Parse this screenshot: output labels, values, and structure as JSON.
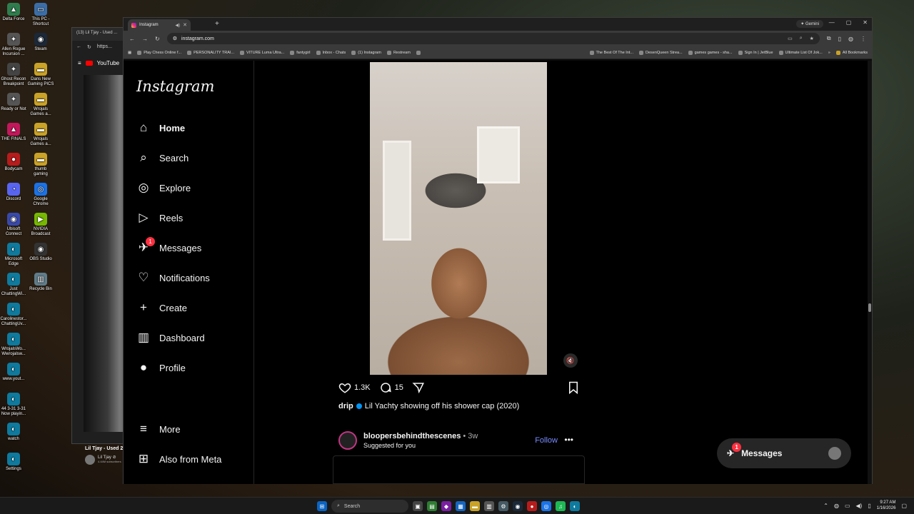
{
  "desktop": {
    "icons": [
      {
        "label": "Delta Force",
        "glyph": "▲",
        "color": "#2f7d4e"
      },
      {
        "label": "This PC - Shortcut",
        "glyph": "▭",
        "color": "#3b6ea8"
      },
      {
        "label": "Allen Rogue Incursion ...",
        "glyph": "✦",
        "color": "#555"
      },
      {
        "label": "Steam",
        "glyph": "◉",
        "color": "#1b2838"
      },
      {
        "label": "Ghost Recon Breakpoint",
        "glyph": "✦",
        "color": "#444"
      },
      {
        "label": "Dans New Gaming PICS",
        "glyph": "▬",
        "color": "#c9a227"
      },
      {
        "label": "Ready or Not",
        "glyph": "✦",
        "color": "#555"
      },
      {
        "label": "Wrojals Games a...",
        "glyph": "▬",
        "color": "#c9a227"
      },
      {
        "label": "THE FINALS",
        "glyph": "▲",
        "color": "#c2185b"
      },
      {
        "label": "Wrojals Games a...",
        "glyph": "▬",
        "color": "#c9a227"
      },
      {
        "label": "Bodycam",
        "glyph": "●",
        "color": "#b71c1c"
      },
      {
        "label": "thumb gaming",
        "glyph": "▬",
        "color": "#c9a227"
      },
      {
        "label": "Discord",
        "glyph": "◔",
        "color": "#5865f2"
      },
      {
        "label": "Google Chrome",
        "glyph": "◎",
        "color": "#1a73e8"
      },
      {
        "label": "Ubisoft Connect",
        "glyph": "◉",
        "color": "#3949ab"
      },
      {
        "label": "NVIDIA Broadcast",
        "glyph": "▶",
        "color": "#76b900"
      },
      {
        "label": "Microsoft Edge",
        "glyph": "◐",
        "color": "#0e7a9e"
      },
      {
        "label": "OBS Studio",
        "glyph": "◉",
        "color": "#333"
      },
      {
        "label": "Just ChattingWi...",
        "glyph": "◐",
        "color": "#0e7a9e"
      },
      {
        "label": "Recycle Bin",
        "glyph": "▥",
        "color": "#607d8b"
      },
      {
        "label": "Carolinestor... ChattingUv...",
        "glyph": "◐",
        "color": "#0e7a9e"
      },
      {
        "label": "WrojalsWo... Wwrojalsw...",
        "glyph": "◐",
        "color": "#0e7a9e"
      },
      {
        "label": "www.yout...",
        "glyph": "◐",
        "color": "#0e7a9e"
      },
      {
        "label": "44 3-31 3-31 Now playin...",
        "glyph": "◐",
        "color": "#0e7a9e"
      },
      {
        "label": "watch",
        "glyph": "◐",
        "color": "#0e7a9e"
      },
      {
        "label": "Settings",
        "glyph": "◐",
        "color": "#0e7a9e"
      }
    ]
  },
  "youtube_window": {
    "tab_title": "(13) Lil Tjay - Used ...",
    "address": "https...",
    "brand": "YouTube",
    "video_title": "Lil Tjay - Used 2...",
    "channel": "Lil Tjay ⊘",
    "subscribers": "4.44M subscribers"
  },
  "browser": {
    "tab_title": "Instagram",
    "gemini_label": "Gemini",
    "url": "instagram.com",
    "bookmarks_left": [
      "Play Chess Online f...",
      "PERSONALITY TRAI...",
      "VITURE Luma Ultra...",
      "fantygirl",
      "Inbox - Chats",
      "(1) Instagram",
      "Restream",
      ""
    ],
    "bookmarks_right": [
      "The Best Of The Int...",
      "DesenQueen Strea...",
      "games games - sha...",
      "Sign In | JetBlue",
      "Ultimate List Of Jok..."
    ],
    "all_bookmarks": "All Bookmarks"
  },
  "instagram": {
    "logo": "Instagram",
    "nav": [
      {
        "label": "Home",
        "icon": "home-icon",
        "glyph": "⌂"
      },
      {
        "label": "Search",
        "icon": "search-icon",
        "glyph": "⌕"
      },
      {
        "label": "Explore",
        "icon": "compass-icon",
        "glyph": "◎"
      },
      {
        "label": "Reels",
        "icon": "reels-icon",
        "glyph": "▷"
      },
      {
        "label": "Messages",
        "icon": "messenger-icon",
        "glyph": "✈",
        "badge": "1"
      },
      {
        "label": "Notifications",
        "icon": "heart-icon",
        "glyph": "♡"
      },
      {
        "label": "Create",
        "icon": "plus-icon",
        "glyph": "+"
      },
      {
        "label": "Dashboard",
        "icon": "chart-icon",
        "glyph": "▥"
      },
      {
        "label": "Profile",
        "icon": "avatar-icon",
        "glyph": "●"
      }
    ],
    "bottom_nav": [
      {
        "label": "More",
        "icon": "menu-icon",
        "glyph": "≡"
      },
      {
        "label": "Also from Meta",
        "icon": "meta-icon",
        "glyph": "⊞"
      }
    ],
    "post": {
      "likes": "1.3K",
      "comments": "15",
      "author": "drip",
      "caption": "Lil Yachty showing off his shower cap (2020)"
    },
    "suggested": {
      "username": "bloopersbehindthescenes",
      "age": "• 3w",
      "subtitle": "Suggested for you",
      "follow": "Follow"
    },
    "messages_pill": {
      "label": "Messages",
      "badge": "1"
    }
  },
  "taskbar": {
    "search_placeholder": "Search",
    "time": "9:27 AM",
    "date": "1/16/2026"
  }
}
